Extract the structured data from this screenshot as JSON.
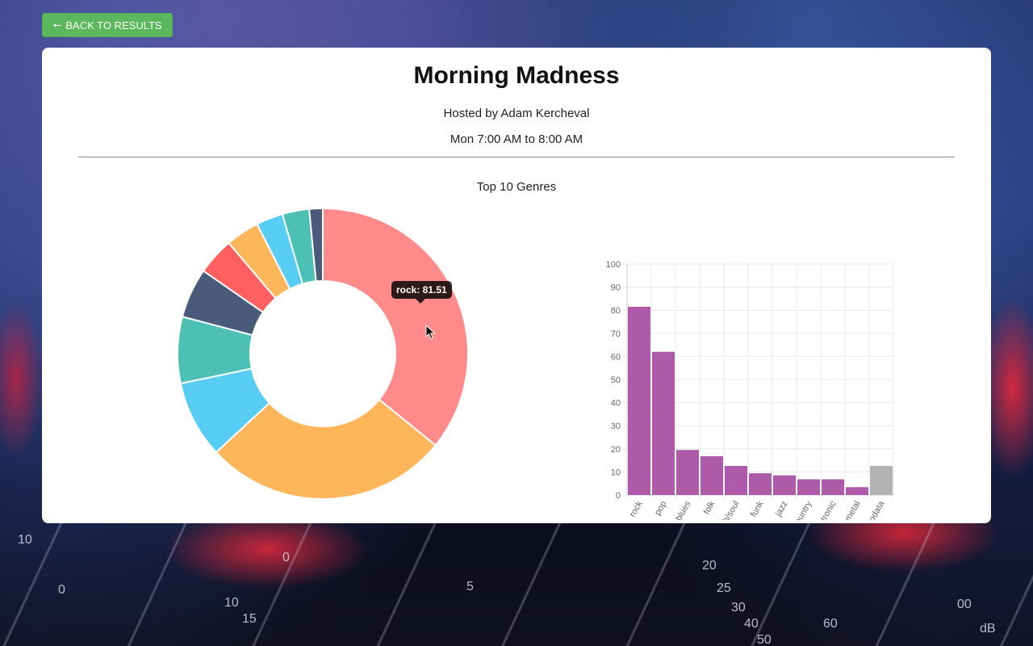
{
  "nav": {
    "back_label": "BACK TO RESULTS",
    "back_icon": "arrow-left-icon"
  },
  "show": {
    "title": "Morning Madness",
    "host": "Hosted by Adam Kercheval",
    "time": "Mon 7:00 AM to 8:00 AM"
  },
  "chart_title": "Top 10 Genres",
  "tooltip": {
    "text": "rock: 81.51"
  },
  "mixer_labels": [
    "10",
    "0",
    "0",
    "5",
    "10",
    "15",
    "20",
    "25",
    "30",
    "40",
    "50",
    "60",
    "00",
    "dB"
  ],
  "chart_data": [
    {
      "type": "doughnut",
      "categories": [
        "rock",
        "pop",
        "blues",
        "folk",
        "r&b/soul",
        "funk",
        "jazz",
        "country",
        "electronic",
        "metal"
      ],
      "values": [
        81.51,
        62.0,
        19.5,
        16.8,
        12.6,
        9.4,
        8.5,
        6.8,
        6.8,
        3.4
      ],
      "colors": [
        "#ff8a8a",
        "#ffb55a",
        "#57cdf3",
        "#4dc0b5",
        "#4a5a7a",
        "#ff5f5f",
        "#ffb55a",
        "#57cdf3",
        "#4dc0b5",
        "#4a5a7a"
      ]
    },
    {
      "type": "bar",
      "categories": [
        "rock",
        "pop",
        "blues",
        "folk",
        "r&b/soul",
        "funk",
        "jazz",
        "country",
        "electronic",
        "metal",
        "nodata"
      ],
      "values": [
        81.51,
        62.0,
        19.5,
        16.8,
        12.6,
        9.4,
        8.5,
        6.8,
        6.8,
        3.4,
        12.6
      ],
      "colors": [
        "#ad5aa9",
        "#ad5aa9",
        "#ad5aa9",
        "#ad5aa9",
        "#ad5aa9",
        "#ad5aa9",
        "#ad5aa9",
        "#ad5aa9",
        "#ad5aa9",
        "#ad5aa9",
        "#b3b3b3"
      ],
      "ylim": [
        0,
        100
      ],
      "yticks": [
        0,
        10,
        20,
        30,
        40,
        50,
        60,
        70,
        80,
        90,
        100
      ],
      "grid": true
    }
  ]
}
